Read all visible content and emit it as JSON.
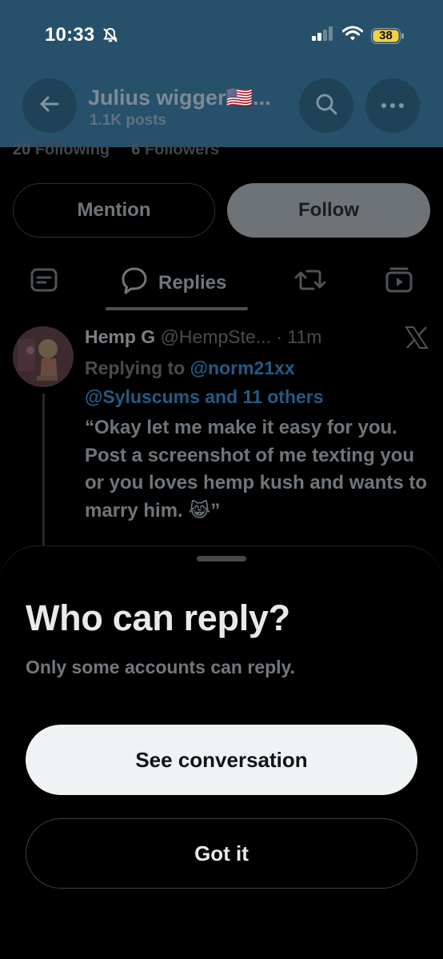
{
  "status_bar": {
    "time": "10:33",
    "battery": "38",
    "icons": [
      "bell-slash-icon",
      "signal-icon",
      "wifi-icon",
      "battery-icon"
    ]
  },
  "profile_header": {
    "name": "Julius wigger🇺🇸...",
    "posts": "1.1K posts"
  },
  "follow_stats": {
    "following_count": "20",
    "following_label": "Following",
    "followers_count": "6",
    "followers_label": "Followers"
  },
  "actions": {
    "mention": "Mention",
    "follow": "Follow"
  },
  "tabs": {
    "active_label": "Replies",
    "icons": [
      "posts-icon",
      "replies-icon",
      "repost-icon",
      "media-icon"
    ]
  },
  "tweet": {
    "name": "Hemp G",
    "handle_time": "@HempSte... · 11m",
    "replying_prefix": "Replying to",
    "mention_1": "@norm21xx",
    "mention_2": "@Syluscums and 11 others",
    "text": "“Okay let me make it easy for you. Post a screenshot of me texting you or you loves hemp kush and wants to marry him. 😹”"
  },
  "sheet": {
    "title": "Who can reply?",
    "subtitle": "Only some accounts can reply.",
    "primary_button": "See conversation",
    "secondary_button": "Got it"
  },
  "colors": {
    "header_bg": "#27506b",
    "sheet_bg": "#000000",
    "primary_button_bg": "#eff3f4",
    "mention_link": "#245a85",
    "battery_fill": "#f5d142"
  }
}
